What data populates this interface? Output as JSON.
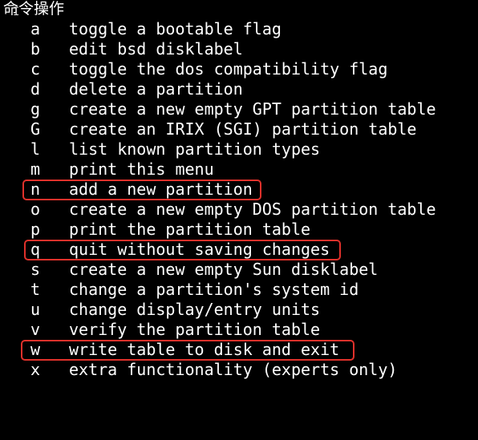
{
  "heading": "命令操作",
  "commands": [
    {
      "key": "a",
      "desc": "toggle a bootable flag"
    },
    {
      "key": "b",
      "desc": "edit bsd disklabel"
    },
    {
      "key": "c",
      "desc": "toggle the dos compatibility flag"
    },
    {
      "key": "d",
      "desc": "delete a partition"
    },
    {
      "key": "g",
      "desc": "create a new empty GPT partition table"
    },
    {
      "key": "G",
      "desc": "create an IRIX (SGI) partition table"
    },
    {
      "key": "l",
      "desc": "list known partition types"
    },
    {
      "key": "m",
      "desc": "print this menu"
    },
    {
      "key": "n",
      "desc": "add a new partition"
    },
    {
      "key": "o",
      "desc": "create a new empty DOS partition table"
    },
    {
      "key": "p",
      "desc": "print the partition table"
    },
    {
      "key": "q",
      "desc": "quit without saving changes"
    },
    {
      "key": "s",
      "desc": "create a new empty Sun disklabel"
    },
    {
      "key": "t",
      "desc": "change a partition's system id"
    },
    {
      "key": "u",
      "desc": "change display/entry units"
    },
    {
      "key": "v",
      "desc": "verify the partition table"
    },
    {
      "key": "w",
      "desc": "write table to disk and exit"
    },
    {
      "key": "x",
      "desc": "extra functionality (experts only)"
    }
  ],
  "colors": {
    "background": "#000000",
    "text": "#ffffff",
    "highlight": "#e0312b"
  }
}
